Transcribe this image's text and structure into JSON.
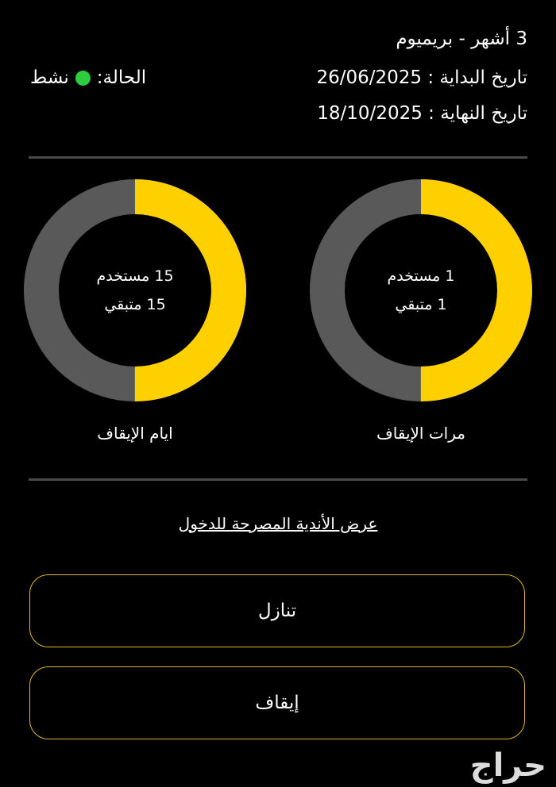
{
  "subscription": {
    "plan_title": "3 أشهر - بريميوم",
    "start_date_label": "تاريخ البداية :",
    "start_date_value": "26/06/2025",
    "end_date_label": "تاريخ النهاية :",
    "end_date_value": "18/10/2025",
    "status_label": "الحالة:",
    "status_value": "نشط",
    "status_color": "#2ecc40"
  },
  "freeze_stats": [
    {
      "used_text": "1 مستخدم",
      "remaining_text": "1 متبقي",
      "used": 1,
      "remaining": 1,
      "used_fraction": 0.5,
      "caption": "مرات الإيقاف"
    },
    {
      "used_text": "15 مستخدم",
      "remaining_text": "15 متبقي",
      "used": 15,
      "remaining": 15,
      "used_fraction": 0.5,
      "caption": "ايام الإيقاف"
    }
  ],
  "colors": {
    "accent": "#ffd000",
    "ring_track": "#595959",
    "divider": "#4a4a4a",
    "button_border": "#e0b91f",
    "background": "#000000"
  },
  "links": {
    "clubs_label": "عرض الأندية المصرحة للدخول"
  },
  "actions": {
    "waive_label": "تنازل",
    "freeze_label": "إيقاف"
  },
  "watermark": {
    "text": "حراج"
  }
}
